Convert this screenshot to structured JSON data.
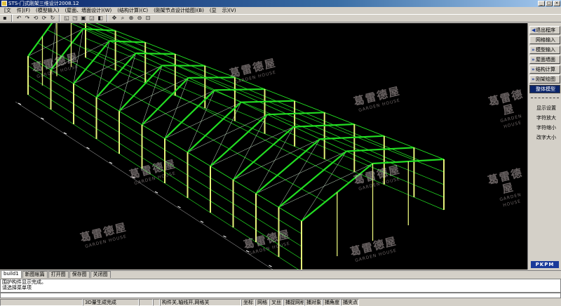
{
  "app": {
    "title": "STS-门式刚架三维设计2008.12",
    "window_buttons": {
      "minimize": "_",
      "maximize": "□",
      "close": "×"
    }
  },
  "menu": [
    "[文",
    "件](F)",
    "(模型输入)",
    "(屋面、墙面设计)(W)",
    "(结构计算)(C)",
    "(刚架节点设计绘图)(B)",
    "(显",
    "示)(V)"
  ],
  "toolbar": {
    "icons": [
      {
        "name": "save-icon",
        "glyph": "▪"
      },
      {
        "name": "undo-icon",
        "glyph": "↶"
      },
      {
        "name": "redo-icon",
        "glyph": "↷"
      },
      {
        "name": "rotate-left-icon",
        "glyph": "⟲"
      },
      {
        "name": "rotate-right-icon",
        "glyph": "⟳"
      },
      {
        "name": "rotate-icon",
        "glyph": "↻"
      },
      {
        "name": "view-front-icon",
        "glyph": "◱"
      },
      {
        "name": "view-side-icon",
        "glyph": "◳"
      },
      {
        "name": "view-3d-icon",
        "glyph": "▣"
      },
      {
        "name": "view-top-icon",
        "glyph": "◲"
      },
      {
        "name": "view-iso-icon",
        "glyph": "◧"
      },
      {
        "name": "pan-icon",
        "glyph": "✥"
      },
      {
        "name": "zoom-window-icon",
        "glyph": "⌕"
      },
      {
        "name": "zoom-in-icon",
        "glyph": "⊕"
      },
      {
        "name": "zoom-out-icon",
        "glyph": "⊖"
      },
      {
        "name": "zoom-extents-icon",
        "glyph": "⊡"
      }
    ]
  },
  "viewport": {
    "background": "#000000",
    "frame_color": "#22dd22",
    "column_color": "#e6f27a",
    "watermark": {
      "cn": "葛雷德屋",
      "en": "GARDEN HOUSE"
    }
  },
  "side_panel": {
    "buttons": [
      {
        "label": "退出程序",
        "mark": "◀"
      },
      {
        "label": "网格输入",
        "mark": ""
      },
      {
        "label": "模型输入",
        "mark": "»"
      },
      {
        "label": "屋面墙面",
        "mark": "»"
      },
      {
        "label": "结构计算",
        "mark": "»"
      },
      {
        "label": "刚架绘图",
        "mark": "»"
      },
      {
        "label": "整体模型",
        "mark": "",
        "active": true
      }
    ],
    "divider": "————",
    "items": [
      "显示设置",
      "字符放大",
      "字符缩小",
      "改字大小"
    ],
    "logo": "PKPM"
  },
  "tabs": [
    "build1",
    "新图帐篇",
    "打开图",
    "保存图",
    "关闭图"
  ],
  "command": {
    "lines": [
      "围护构件显示完成。",
      "请选择菜单项"
    ]
  },
  "status": {
    "cells": [
      "",
      "3D量生成完成",
      "",
      "",
      "构件关,轴线开,网格关",
      "坐标",
      "网格",
      "叉丝",
      "捕捉网格",
      "捕对象",
      "捕角度",
      "捕夹点"
    ]
  }
}
